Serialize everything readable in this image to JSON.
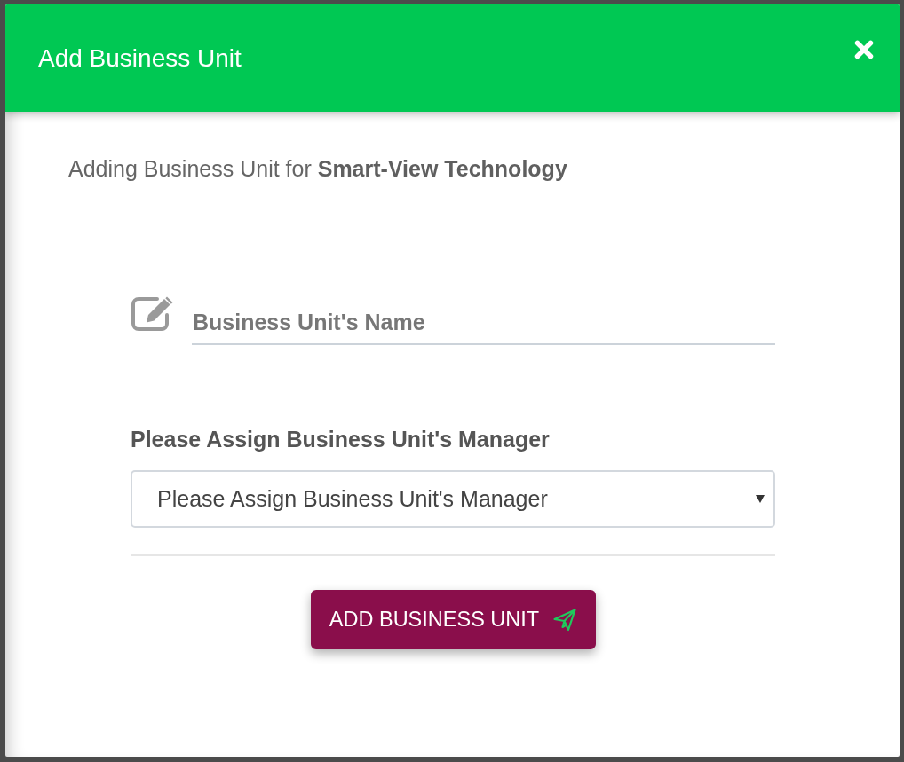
{
  "header": {
    "title": "Add Business Unit"
  },
  "intro": "Adding Business Unit for **Smart-View Technology**",
  "name_field": {
    "placeholder": "Business Unit's Name"
  },
  "manager_field": {
    "label": "Please Assign Business Unit's Manager",
    "value": "Please Assign Business Unit's Manager"
  },
  "submit_button": {
    "label": "ADD BUSINESS UNIT"
  }
}
